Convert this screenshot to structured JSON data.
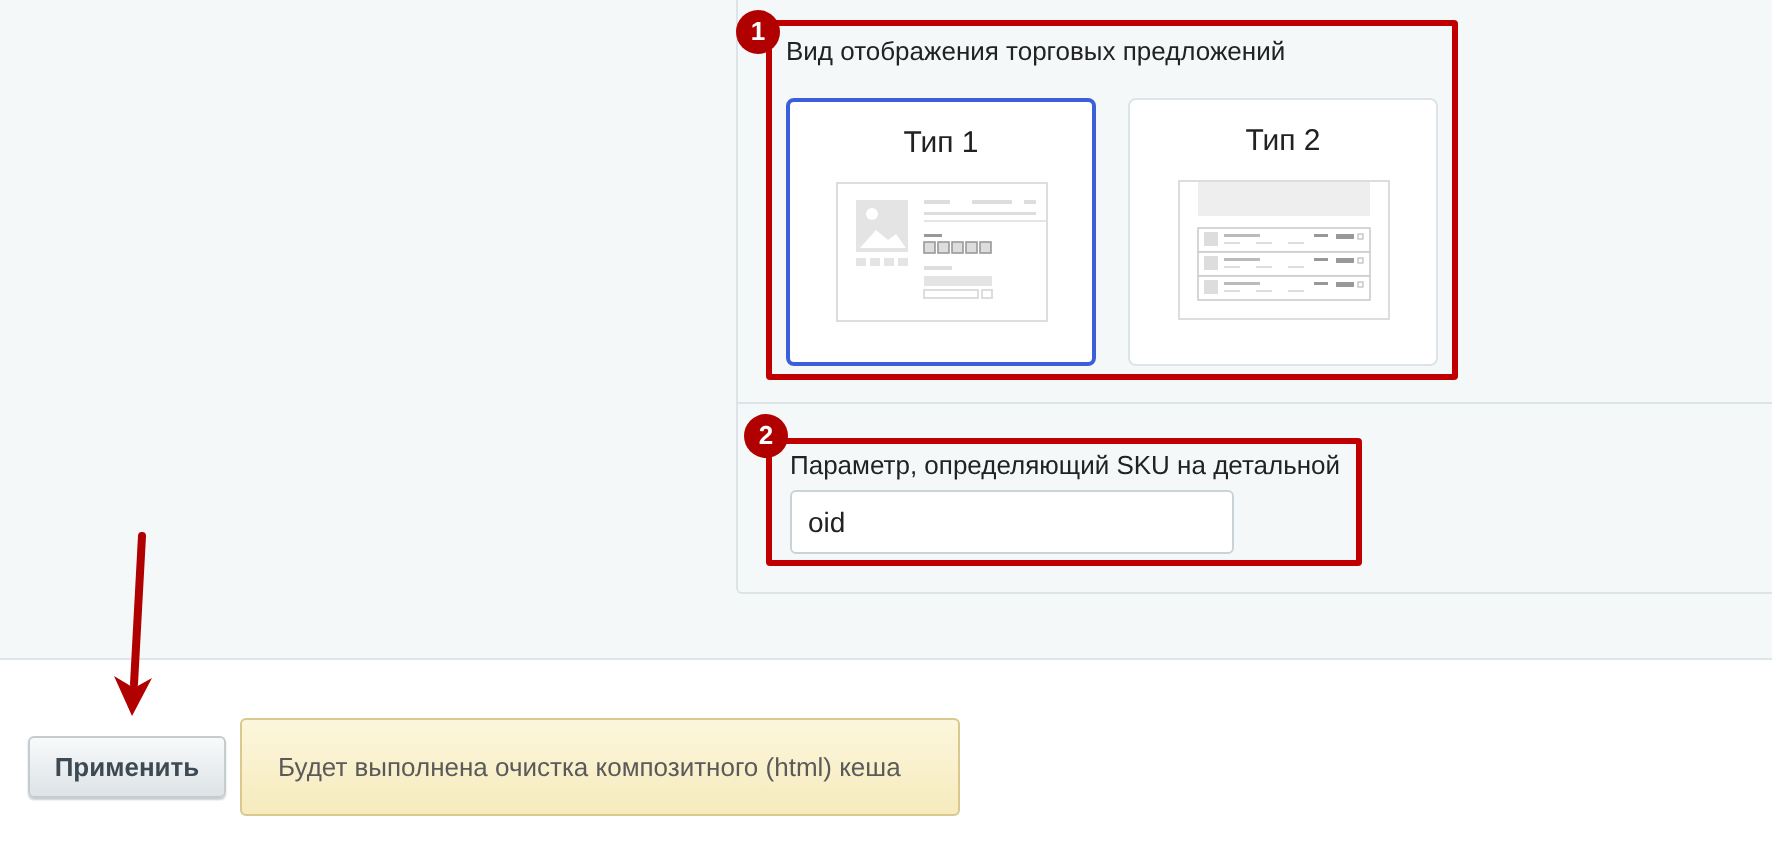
{
  "display_section": {
    "marker": "1",
    "label": "Вид отображения торговых предложений",
    "options": [
      {
        "label": "Тип 1",
        "kind": "detail",
        "selected": true
      },
      {
        "label": "Тип 2",
        "kind": "list",
        "selected": false
      }
    ]
  },
  "sku_section": {
    "marker": "2",
    "label": "Параметр, определяющий SKU на детальной",
    "value": "oid"
  },
  "apply_button": "Применить",
  "notice": "Будет выполнена очистка композитного (html) кеша"
}
